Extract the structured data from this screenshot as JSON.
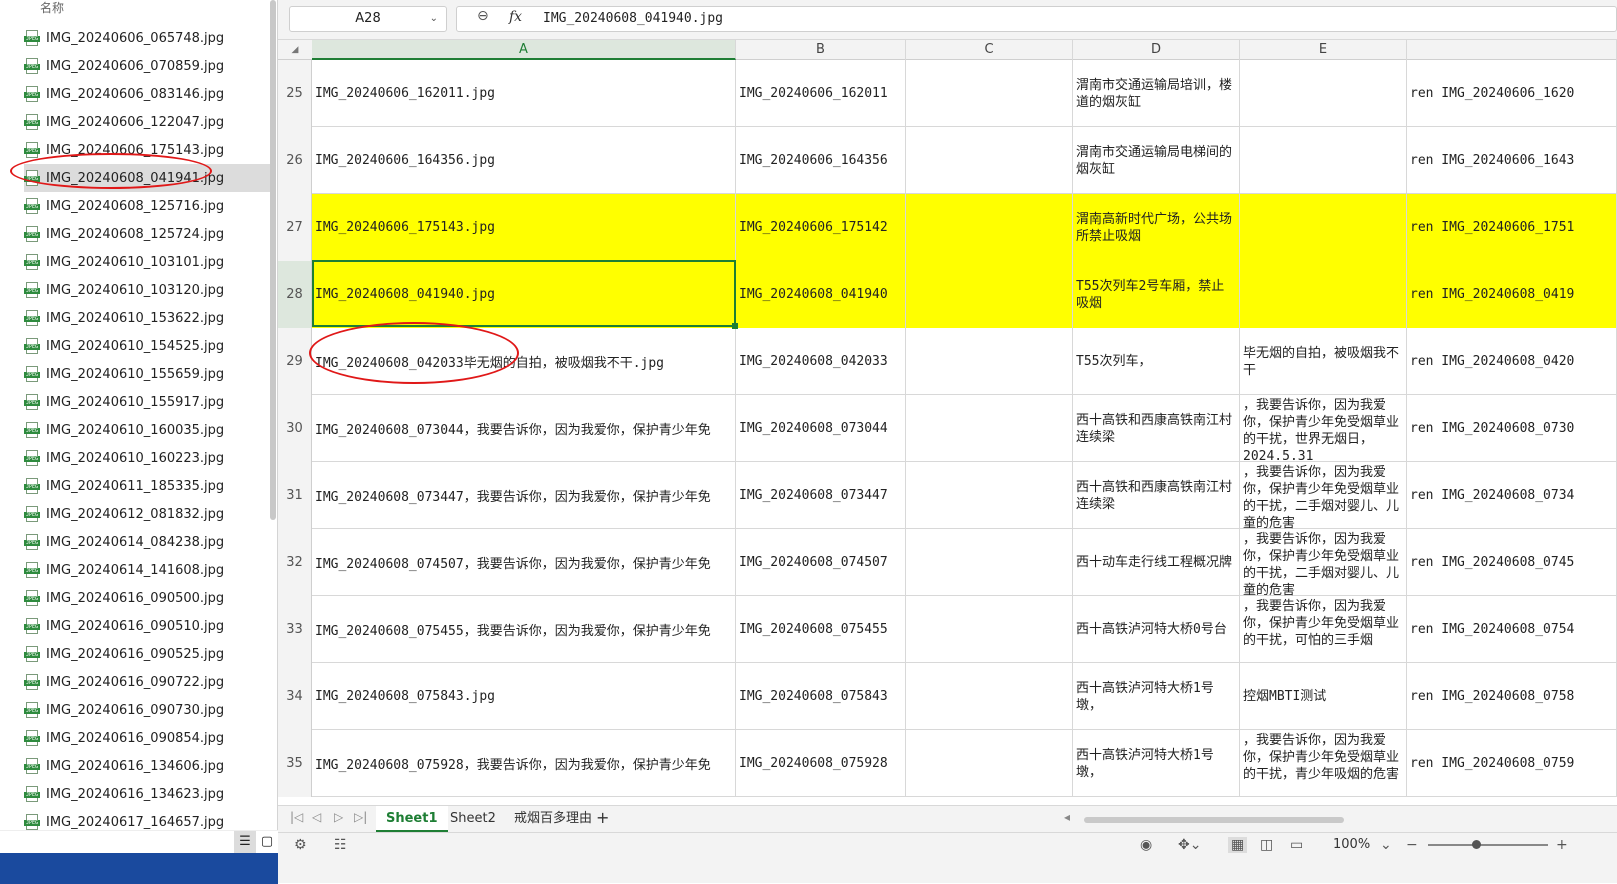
{
  "explorer": {
    "header": "名称",
    "files": [
      "IMG_20240606_065748.jpg",
      "IMG_20240606_070859.jpg",
      "IMG_20240606_083146.jpg",
      "IMG_20240606_122047.jpg",
      "IMG_20240606_175143.jpg",
      "IMG_20240608_041941.jpg",
      "IMG_20240608_125716.jpg",
      "IMG_20240608_125724.jpg",
      "IMG_20240610_103101.jpg",
      "IMG_20240610_103120.jpg",
      "IMG_20240610_153622.jpg",
      "IMG_20240610_154525.jpg",
      "IMG_20240610_155659.jpg",
      "IMG_20240610_155917.jpg",
      "IMG_20240610_160035.jpg",
      "IMG_20240610_160223.jpg",
      "IMG_20240611_185335.jpg",
      "IMG_20240612_081832.jpg",
      "IMG_20240614_084238.jpg",
      "IMG_20240614_141608.jpg",
      "IMG_20240616_090500.jpg",
      "IMG_20240616_090510.jpg",
      "IMG_20240616_090525.jpg",
      "IMG_20240616_090722.jpg",
      "IMG_20240616_090730.jpg",
      "IMG_20240616_090854.jpg",
      "IMG_20240616_134606.jpg",
      "IMG_20240616_134623.jpg",
      "IMG_20240617_164657.jpg"
    ],
    "selected_index": 5,
    "icon_tag": "JPEG"
  },
  "formula_bar": {
    "name_box": "A28",
    "fx_label": "fx",
    "value": "IMG_20240608_041940.jpg"
  },
  "columns": [
    "A",
    "B",
    "C",
    "D",
    "E"
  ],
  "rows": [
    {
      "n": "25",
      "a": "IMG_20240606_162011.jpg",
      "b": "IMG_20240606_162011",
      "c": "",
      "d": "渭南市交通运输局培训，楼道的烟灰缸",
      "e": "",
      "f": "ren IMG_20240606_1620",
      "hl": false
    },
    {
      "n": "26",
      "a": "IMG_20240606_164356.jpg",
      "b": "IMG_20240606_164356",
      "c": "",
      "d": "渭南市交通运输局电梯间的烟灰缸",
      "e": "",
      "f": "ren IMG_20240606_1643",
      "hl": false
    },
    {
      "n": "27",
      "a": "IMG_20240606_175143.jpg",
      "b": "IMG_20240606_175142",
      "c": "",
      "d": "渭南高新时代广场，公共场所禁止吸烟",
      "e": "",
      "f": "ren IMG_20240606_1751",
      "hl": true
    },
    {
      "n": "28",
      "a": "IMG_20240608_041940.jpg",
      "b": "IMG_20240608_041940",
      "c": "",
      "d": "T55次列车2号车厢，禁止吸烟",
      "e": "",
      "f": "ren IMG_20240608_0419",
      "hl": true
    },
    {
      "n": "29",
      "a": "IMG_20240608_042033毕无烟的自拍，被吸烟我不干.jpg",
      "b": "IMG_20240608_042033",
      "c": "",
      "d": "T55次列车，",
      "e": "毕无烟的自拍，被吸烟我不干",
      "f": "ren IMG_20240608_0420",
      "hl": false
    },
    {
      "n": "30",
      "a": "IMG_20240608_073044，我要告诉你，因为我爱你，保护青少年免",
      "b": "IMG_20240608_073044",
      "c": "",
      "d": "西十高铁和西康高铁南江村连续梁",
      "e": "，我要告诉你，因为我爱你，保护青少年免受烟草业的干扰，世界无烟日，2024.5.31",
      "f": "ren IMG_20240608_0730",
      "hl": false
    },
    {
      "n": "31",
      "a": "IMG_20240608_073447，我要告诉你，因为我爱你，保护青少年免",
      "b": "IMG_20240608_073447",
      "c": "",
      "d": "西十高铁和西康高铁南江村连续梁",
      "e": "，我要告诉你，因为我爱你，保护青少年免受烟草业的干扰，二手烟对婴儿、儿童的危害",
      "f": "ren IMG_20240608_0734",
      "hl": false
    },
    {
      "n": "32",
      "a": "IMG_20240608_074507，我要告诉你，因为我爱你，保护青少年免",
      "b": "IMG_20240608_074507",
      "c": "",
      "d": "西十动车走行线工程概况牌",
      "e": "，我要告诉你，因为我爱你，保护青少年免受烟草业的干扰，二手烟对婴儿、儿童的危害",
      "f": "ren IMG_20240608_0745",
      "hl": false
    },
    {
      "n": "33",
      "a": "IMG_20240608_075455，我要告诉你，因为我爱你，保护青少年免",
      "b": "IMG_20240608_075455",
      "c": "",
      "d": "西十高铁泸河特大桥0号台",
      "e": "，我要告诉你，因为我爱你，保护青少年免受烟草业的干扰，可怕的三手烟",
      "f": "ren IMG_20240608_0754",
      "hl": false
    },
    {
      "n": "34",
      "a": "IMG_20240608_075843.jpg",
      "b": "IMG_20240608_075843",
      "c": "",
      "d": "西十高铁泸河特大桥1号墩，",
      "e": "控烟MBTI测试",
      "f": "ren IMG_20240608_0758",
      "hl": false
    },
    {
      "n": "35",
      "a": "IMG_20240608_075928，我要告诉你，因为我爱你，保护青少年免",
      "b": "IMG_20240608_075928",
      "c": "",
      "d": "西十高铁泸河特大桥1号墩，",
      "e": "，我要告诉你，因为我爱你，保护青少年免受烟草业的干扰，青少年吸烟的危害",
      "f": "ren IMG_20240608_0759",
      "hl": false
    }
  ],
  "sheets": [
    "Sheet1",
    "Sheet2",
    "戒烟百多理由"
  ],
  "active_sheet": 0,
  "status": {
    "zoom": "100%",
    "zoom_fraction": 0.4
  }
}
